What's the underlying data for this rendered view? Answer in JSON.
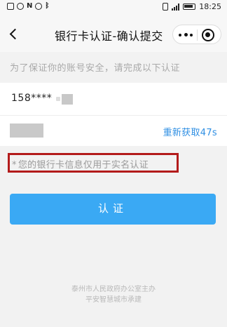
{
  "statusbar": {
    "left_icons": [
      "calendar-icon",
      "notification-icon",
      "nfc-icon",
      "alarm-icon",
      "bluetooth-icon"
    ],
    "nfc_label": "N",
    "right_icons": [
      "vibrate-icon",
      "signal-icon",
      "battery-icon"
    ],
    "time": "18:25"
  },
  "navbar": {
    "title": "银行卡认证-确认提交"
  },
  "subtitle": "为了保证你的账号安全，请完成以下认证",
  "phone": {
    "number": "158****"
  },
  "code": {
    "resend_label": "重新获取47s"
  },
  "notice": {
    "star": "*",
    "text": "您的银行卡信息仅用于实名认证"
  },
  "submit": {
    "label": "认证"
  },
  "footer": {
    "line1": "泰州市人民政府办公室主办",
    "line2": "平安智慧城市承建"
  },
  "colors": {
    "accent": "#3aa9f4",
    "link": "#2f8fe3",
    "highlight_border": "#b31b1b"
  }
}
